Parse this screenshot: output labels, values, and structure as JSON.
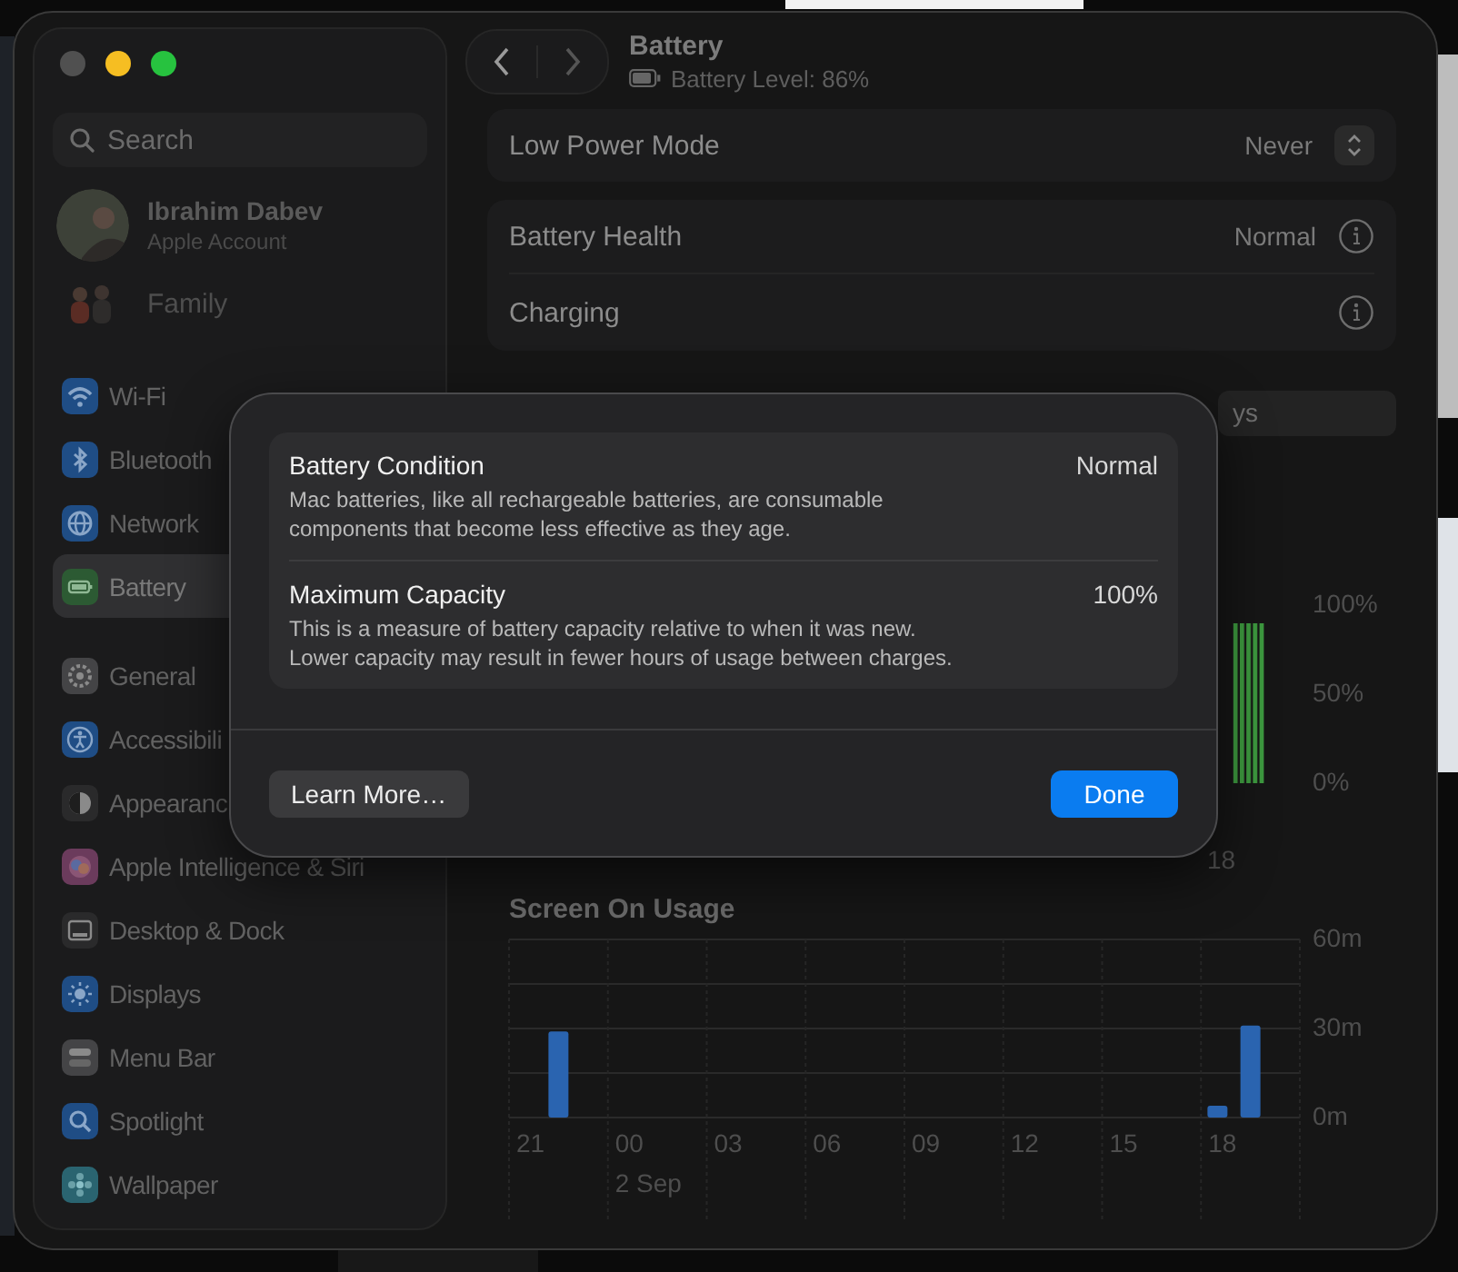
{
  "window": {
    "title": "Battery",
    "subtitle": "Battery Level: 86%"
  },
  "sidebar": {
    "search": {
      "placeholder": "Search"
    },
    "account": {
      "name": "Ibrahim Dabev",
      "subtitle": "Apple Account"
    },
    "family": {
      "label": "Family"
    },
    "groups": [
      [
        {
          "label": "Wi-Fi",
          "color": "#1f4d85",
          "selected": false
        },
        {
          "label": "Bluetooth",
          "color": "#1f4d85",
          "selected": false
        },
        {
          "label": "Network",
          "color": "#1f4d85",
          "selected": false
        },
        {
          "label": "Battery",
          "color": "#2c5a33",
          "selected": true
        }
      ],
      [
        {
          "label": "General",
          "color": "#444446",
          "selected": false
        },
        {
          "label": "Accessibili",
          "color": "#1f4d85",
          "selected": false
        },
        {
          "label": "Appearanc",
          "color": "#2a2a2b",
          "selected": false
        },
        {
          "label": "Apple Intelligence & Siri",
          "color": "#6b3b5c",
          "selected": false
        },
        {
          "label": "Desktop & Dock",
          "color": "#2a2a2b",
          "selected": false
        },
        {
          "label": "Displays",
          "color": "#1f4d85",
          "selected": false
        },
        {
          "label": "Menu Bar",
          "color": "#444446",
          "selected": false
        },
        {
          "label": "Spotlight",
          "color": "#1f4d85",
          "selected": false
        },
        {
          "label": "Wallpaper",
          "color": "#2a6470",
          "selected": false
        }
      ]
    ]
  },
  "settings": [
    [
      {
        "label": "Low Power Mode",
        "value": "Never",
        "kind": "popup"
      }
    ],
    [
      {
        "label": "Battery Health",
        "value": "Normal",
        "kind": "info"
      },
      {
        "label": "Charging",
        "kind": "info"
      }
    ]
  ],
  "range_tab": {
    "label": "ys"
  },
  "battery_chart": {
    "y_labels": [
      "100%",
      "50%",
      "0%"
    ],
    "x_label": "18"
  },
  "usage_chart": {
    "chart_data": {
      "type": "bar",
      "title": "Screen On Usage",
      "ylim": [
        0,
        60
      ],
      "categories": [
        "21",
        null,
        null,
        "00",
        null,
        null,
        "03",
        null,
        null,
        "06",
        null,
        null,
        "09",
        null,
        null,
        "12",
        null,
        null,
        "15",
        null,
        null,
        "18",
        null,
        null
      ],
      "series": [
        {
          "color": "#2a64b0",
          "values": [
            null,
            29,
            null,
            null,
            null,
            null,
            null,
            null,
            null,
            null,
            null,
            null,
            null,
            null,
            null,
            null,
            null,
            null,
            null,
            null,
            null,
            4,
            31,
            null
          ]
        }
      ],
      "yticks": [
        {
          "value": 0,
          "label": "0m"
        },
        {
          "value": 30,
          "label": "30m"
        },
        {
          "value": 60,
          "label": "60m"
        }
      ],
      "annotations": [
        "2 Sep"
      ]
    }
  },
  "dialog": {
    "sections": [
      {
        "title": "Battery Condition",
        "value": "Normal",
        "description": "Mac batteries, like all rechargeable batteries, are consumable components that become less effective as they age."
      },
      {
        "title": "Maximum Capacity",
        "value": "100%",
        "description": "This is a measure of battery capacity relative to when it was new. Lower capacity may result in fewer hours of usage between charges."
      }
    ],
    "buttons": [
      {
        "label": "Learn More…",
        "kind": "secondary"
      },
      {
        "label": "Done",
        "kind": "primary"
      }
    ]
  }
}
